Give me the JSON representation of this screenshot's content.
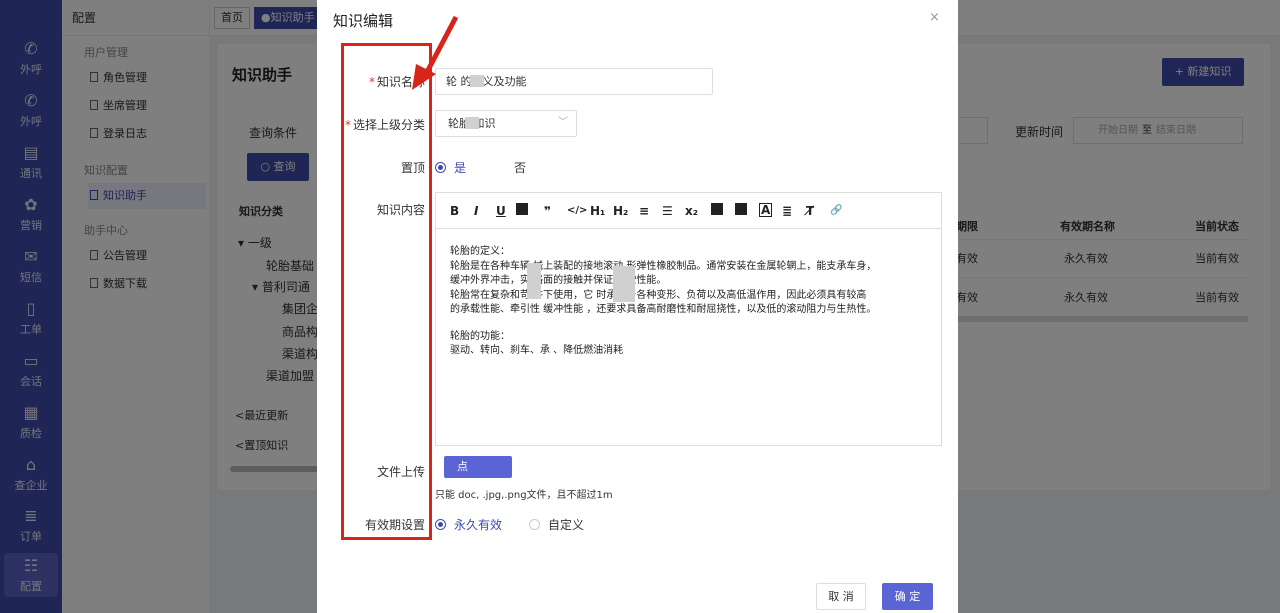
{
  "rail": [
    {
      "icon": "phone-out-icon",
      "label": "外呼",
      "active": false
    },
    {
      "icon": "phone-out-icon",
      "label": "外呼",
      "active": false
    },
    {
      "icon": "notebook-icon",
      "label": "通讯",
      "active": false
    },
    {
      "icon": "gear-icon",
      "label": "营销",
      "active": false
    },
    {
      "icon": "message-icon",
      "label": "短信",
      "active": false
    },
    {
      "icon": "clipboard-icon",
      "label": "工单",
      "active": false
    },
    {
      "icon": "chat-icon",
      "label": "会话",
      "active": false
    },
    {
      "icon": "calendar-check-icon",
      "label": "质检",
      "active": false
    },
    {
      "icon": "building-icon",
      "label": "查企业",
      "active": false
    },
    {
      "icon": "list-icon",
      "label": "订单",
      "active": false
    },
    {
      "icon": "sliders-icon",
      "label": "配置",
      "active": true
    }
  ],
  "subnav": {
    "title": "配置",
    "groups": [
      {
        "label": "用户管理",
        "items": [
          "角色管理",
          "坐席管理",
          "登录日志"
        ]
      },
      {
        "label": "知识配置",
        "items": [
          "知识助手"
        ]
      },
      {
        "label": "助手中心",
        "items": [
          "公告管理",
          "数据下载"
        ]
      }
    ],
    "active": "知识助手"
  },
  "tabs": [
    "首页",
    "●知识助手"
  ],
  "page": {
    "title": "知识助手",
    "new_button": "+ 新建知识",
    "query_label": "查询条件",
    "query_button": "查询",
    "update_time_label": "更新时间",
    "date_start_placeholder": "开始日期",
    "date_sep": "至",
    "date_end_placeholder": "结束日期",
    "tree_header": "知识分类",
    "tree": [
      "一级",
      "轮胎基础",
      "普利司通",
      "集团企",
      "商品构",
      "渠道构",
      "渠道加盟"
    ],
    "side_links": [
      "最近更新",
      "置顶知识"
    ],
    "columns": [
      "期限",
      "有效期名称",
      "当前状态"
    ],
    "rows": [
      {
        "term": "有效",
        "validity": "永久有效",
        "status": "当前有效"
      },
      {
        "term": "有效",
        "validity": "永久有效",
        "status": "当前有效"
      }
    ]
  },
  "modal": {
    "title": "知识编辑",
    "close": "×",
    "fields": {
      "name_label": "知识名称",
      "name_value": "轮   的定义及功能",
      "parent_label": "选择上级分类",
      "parent_value": "轮胎     知识",
      "pin_label": "置顶",
      "pin_yes": "是",
      "pin_no": "否",
      "content_label": "知识内容",
      "upload_label": "文件上传",
      "upload_button": "点",
      "upload_hint": "只能      doc, .jpg,.png文件，且不超过1m",
      "validity_label": "有效期设置",
      "validity_forever": "永久有效",
      "validity_custom": "自定义"
    },
    "toolbar": [
      "B",
      "I",
      "U",
      "",
      "❞",
      "</>",
      "H₁",
      "H₂",
      "≡",
      "☰",
      "x₂",
      "",
      "",
      "A",
      "≣",
      "T̸",
      "🔗"
    ],
    "editor_lines": [
      "轮胎的定义：",
      "轮胎是在各种车辆      械上装配的接地滚动       形弹性橡胶制品。通常安装在金属轮辋上，能支承车身，",
      "缓冲外界冲击，实       路面的接触并保证          行驶性能。",
      "轮胎常在复杂和苛         件下使用，它            时承受着各种变形、负荷以及高低温作用，因此必须具有较高",
      "的承载性能、牵引性        缓冲性能          ，还要求具备高耐磨性和耐屈挠性，以及低的滚动阻力与生热性。",
      "",
      "轮胎的功能：",
      "驱动、转向、刹车、承             、降低燃油消耗"
    ],
    "cancel": "取 消",
    "confirm": "确 定"
  }
}
